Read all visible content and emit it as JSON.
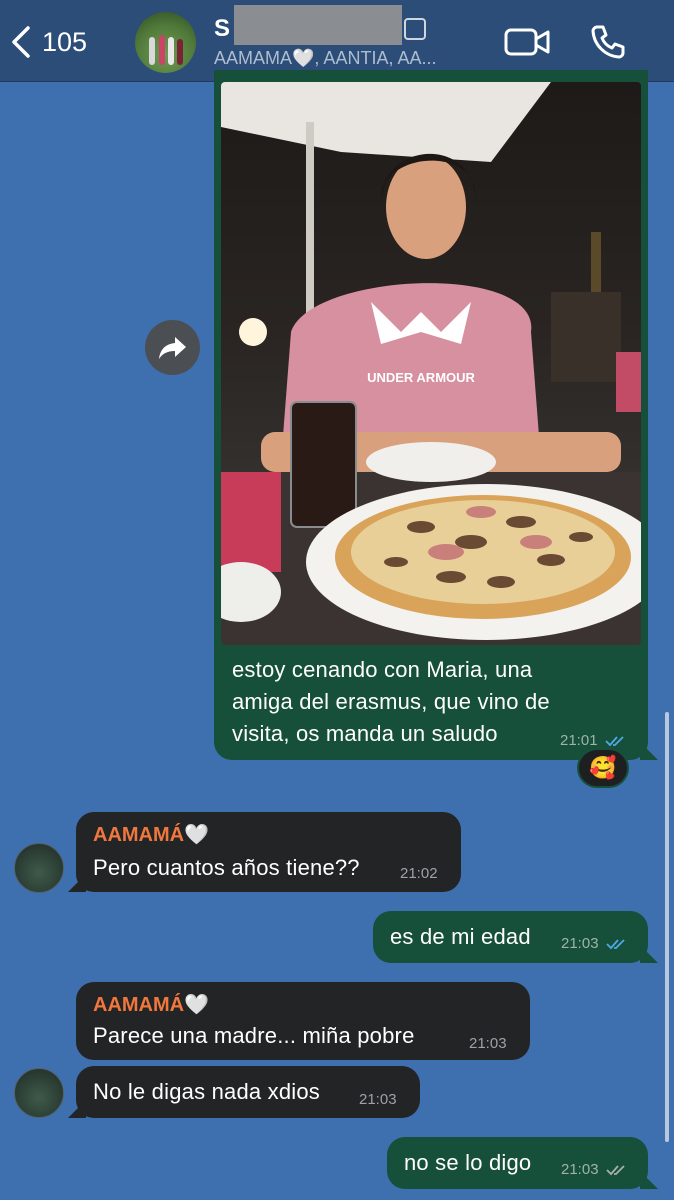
{
  "header": {
    "back_count": "105",
    "title_initial": "S",
    "subtitle": "AAMAMA🤍, AANTIA, AA...",
    "colors": {
      "bar": "#2b4d78",
      "chat_bg": "#3e6fae"
    }
  },
  "messages": [
    {
      "direction": "outgoing",
      "type": "photo",
      "photo_text": "UNDER ARMOUR",
      "text_lines": [
        "estoy cenando con Maria, una",
        "amiga del erasmus, que vino de",
        "visita, os manda un saludo"
      ],
      "time": "21:01",
      "status": "read",
      "reaction": "🥰"
    },
    {
      "direction": "incoming",
      "sender": "AAMAMÁ🤍",
      "text": "Pero cuantos años tiene??",
      "time": "21:02"
    },
    {
      "direction": "outgoing",
      "text": "es de mi edad",
      "time": "21:03",
      "status": "read"
    },
    {
      "direction": "incoming",
      "sender": "AAMAMÁ🤍",
      "text": "Parece una madre... miña pobre",
      "time": "21:03"
    },
    {
      "direction": "incoming",
      "text": "No le digas nada xdios",
      "time": "21:03"
    },
    {
      "direction": "outgoing",
      "text": "no se lo digo",
      "time": "21:03",
      "status": "delivered"
    }
  ],
  "colors": {
    "outgoing_bubble": "#16503a",
    "incoming_bubble": "#222426",
    "sender_name": "#f0773d",
    "read_ticks": "#4fa8e8",
    "delivered_ticks": "#a7b1ab"
  }
}
